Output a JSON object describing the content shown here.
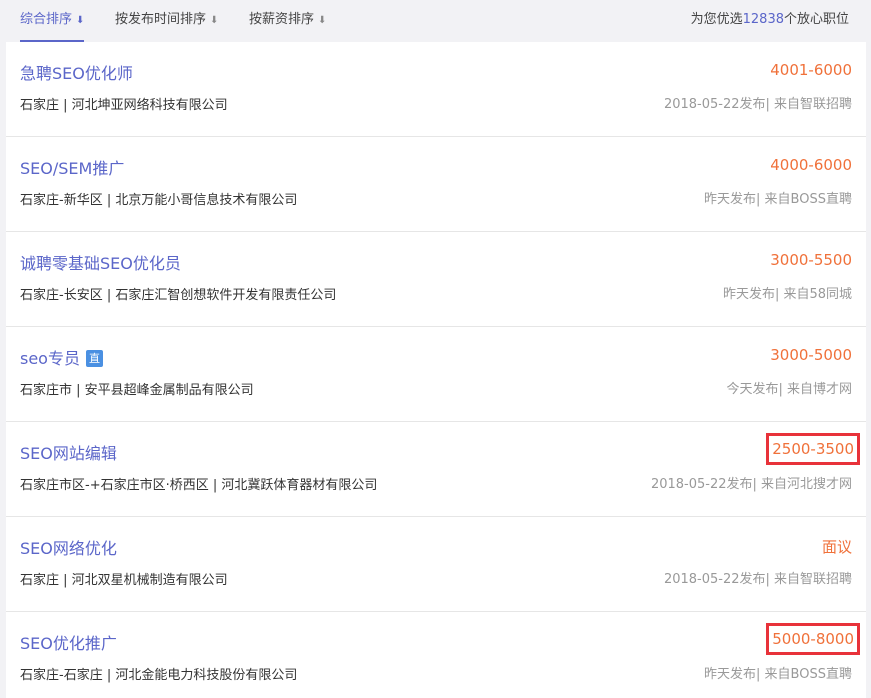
{
  "sort_tabs": [
    {
      "label": "综合排序",
      "arrow": "⬇"
    },
    {
      "label": "按发布时间排序",
      "arrow": "⬇"
    },
    {
      "label": "按薪资排序",
      "arrow": "⬇"
    }
  ],
  "summary": {
    "prefix": "为您优选",
    "count": "12838",
    "suffix": "个放心职位"
  },
  "jobs": [
    {
      "title": "急聘SEO优化师",
      "salary": "4001-6000",
      "location": "石家庄 |",
      "company": "河北坤亚网络科技有限公司",
      "source": "2018-05-22发布| 来自智联招聘"
    },
    {
      "title": "SEO/SEM推广",
      "salary": "4000-6000",
      "location": "石家庄-新华区 |",
      "company": "北京万能小哥信息技术有限公司",
      "source": "昨天发布| 来自BOSS直聘"
    },
    {
      "title": "诚聘零基础SEO优化员",
      "salary": "3000-5500",
      "location": "石家庄-长安区 |",
      "company": "石家庄汇智创想软件开发有限责任公司",
      "source": "昨天发布| 来自58同城"
    },
    {
      "title": "seo专员",
      "badge": "直",
      "salary": "3000-5000",
      "location": "石家庄市 |",
      "company": "安平县超峰金属制品有限公司",
      "source": "今天发布| 来自博才网"
    },
    {
      "title": "SEO网站编辑",
      "salary": "2500-3500",
      "location": "石家庄市区-+石家庄市区·桥西区 |",
      "company": "河北冀跃体育器材有限公司",
      "source": "2018-05-22发布| 来自河北搜才网"
    },
    {
      "title": "SEO网络优化",
      "salary": "面议",
      "location": "石家庄 |",
      "company": "河北双星机械制造有限公司",
      "source": "2018-05-22发布| 来自智联招聘"
    },
    {
      "title": "SEO优化推广",
      "salary": "5000-8000",
      "location": "石家庄-石家庄 |",
      "company": "河北金能电力科技股份有限公司",
      "source": "昨天发布| 来自BOSS直聘"
    }
  ]
}
